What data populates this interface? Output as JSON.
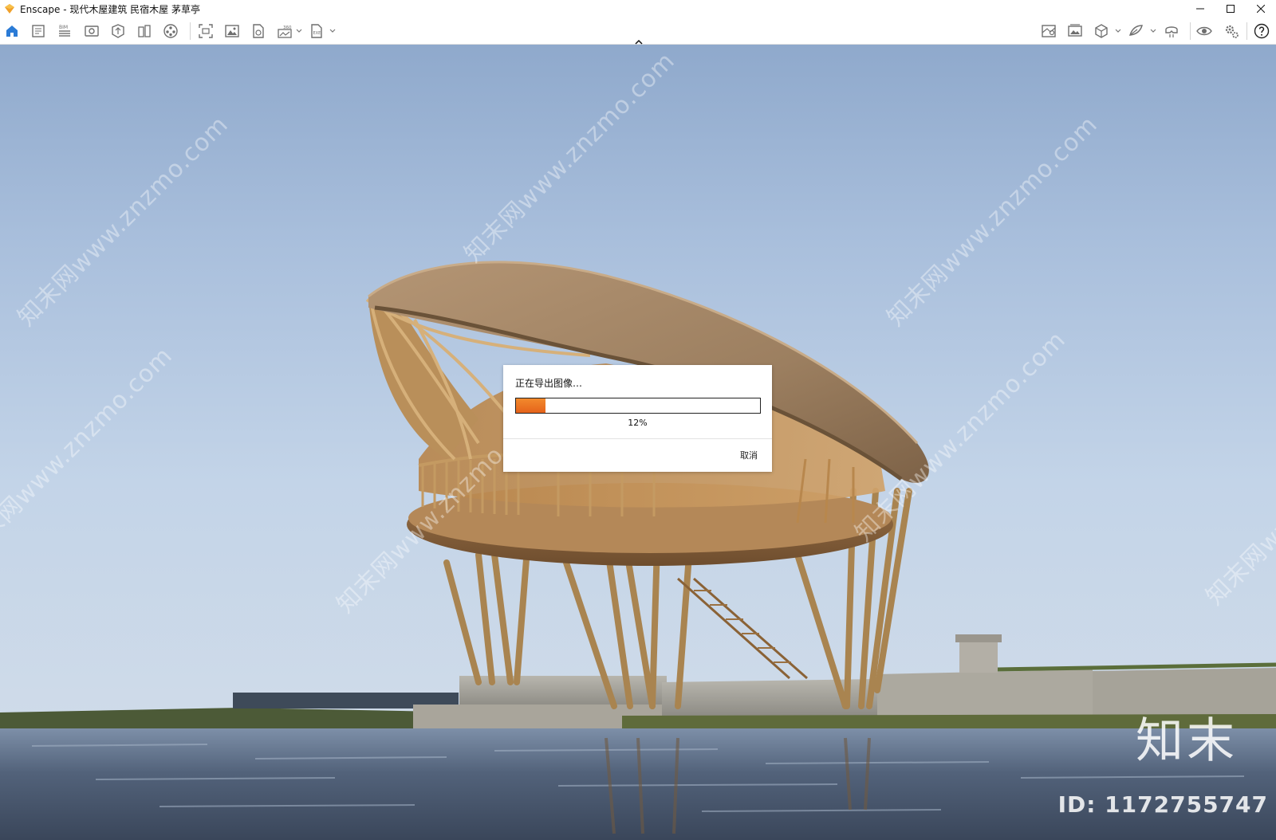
{
  "window": {
    "app_name": "Enscape",
    "title": "Enscape - 现代木屋建筑 民宿木屋 茅草亭"
  },
  "toolbar": {
    "left_icons": [
      "home-icon",
      "document-icon",
      "bim-icon",
      "view-icon",
      "asset-library-icon",
      "sun-study-icon",
      "video-editor-icon",
      "screenshot-icon",
      "batch-render-icon",
      "web-standalone-icon",
      "panorama-icon",
      "export-exe-icon"
    ],
    "right_icons": [
      "map-icon",
      "gallery-icon",
      "cube-icon",
      "feedback-icon",
      "vr-headset-icon",
      "visual-settings-icon",
      "settings-icon",
      "help-icon"
    ],
    "bim_label": "BIM",
    "panorama_label": "360",
    "exe_label": "EXE"
  },
  "dialog": {
    "title": "正在导出图像…",
    "progress": 0.12,
    "percent_label": "12%",
    "cancel_label": "取消"
  },
  "watermark": {
    "text": "知末网www.znzmo.com",
    "brand": "知末",
    "id_label": "ID: 1172755747"
  },
  "colors": {
    "accent": "#e96d1f",
    "home_icon": "#2b7bd6",
    "icon_gray": "#6e6e6e"
  }
}
